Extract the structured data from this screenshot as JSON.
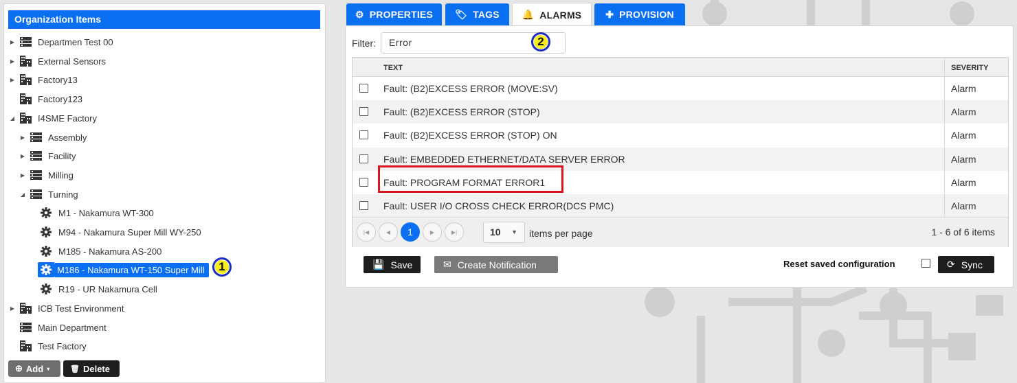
{
  "left": {
    "title": "Organization Items",
    "tree": [
      {
        "label": "Departmen Test 00",
        "icon": "server-icon",
        "arrow": "collapsed",
        "level": 0
      },
      {
        "label": "External Sensors",
        "icon": "building-icon",
        "arrow": "collapsed",
        "level": 0
      },
      {
        "label": "Factory13",
        "icon": "building-icon",
        "arrow": "collapsed",
        "level": 0
      },
      {
        "label": "Factory123",
        "icon": "building-icon",
        "arrow": "none",
        "level": 0
      },
      {
        "label": "I4SME Factory",
        "icon": "building-icon",
        "arrow": "expanded",
        "level": 0
      },
      {
        "label": "Assembly",
        "icon": "server-icon",
        "arrow": "collapsed",
        "level": 1
      },
      {
        "label": "Facility",
        "icon": "server-icon",
        "arrow": "collapsed",
        "level": 1
      },
      {
        "label": "Milling",
        "icon": "server-icon",
        "arrow": "collapsed",
        "level": 1
      },
      {
        "label": "Turning",
        "icon": "server-icon",
        "arrow": "expanded",
        "level": 1
      },
      {
        "label": "M1 - Nakamura WT-300",
        "icon": "gear-icon",
        "arrow": "none",
        "level": 2
      },
      {
        "label": "M94 - Nakamura Super Mill WY-250",
        "icon": "gear-icon",
        "arrow": "none",
        "level": 2
      },
      {
        "label": "M185 - Nakamura AS-200",
        "icon": "gear-icon",
        "arrow": "none",
        "level": 2
      },
      {
        "label": "M186 - Nakamura WT-150 Super Mill",
        "icon": "gear-icon",
        "arrow": "none",
        "level": 2,
        "selected": true
      },
      {
        "label": "R19 - UR Nakamura Cell",
        "icon": "gear-icon",
        "arrow": "none",
        "level": 2
      },
      {
        "label": "ICB Test Environment",
        "icon": "building-icon",
        "arrow": "collapsed",
        "level": 0
      },
      {
        "label": "Main Department",
        "icon": "server-icon",
        "arrow": "none",
        "level": 0
      },
      {
        "label": "Test Factory",
        "icon": "building-icon",
        "arrow": "none",
        "level": 0
      }
    ],
    "add_label": "Add",
    "delete_label": "Delete",
    "callout_1": "1"
  },
  "tabs": [
    {
      "label": "PROPERTIES",
      "icon": "gear-icon"
    },
    {
      "label": "TAGS",
      "icon": "tag-icon"
    },
    {
      "label": "ALARMS",
      "icon": "bell-icon",
      "active": true
    },
    {
      "label": "PROVISION",
      "icon": "plus-icon"
    }
  ],
  "alarms": {
    "filter_label": "Filter:",
    "filter_value": "Error",
    "callout_2": "2",
    "col_text": "TEXT",
    "col_severity": "SEVERITY",
    "rows": [
      {
        "text": "Fault: (B2)EXCESS ERROR (MOVE:SV)",
        "severity": "Alarm"
      },
      {
        "text": "Fault: (B2)EXCESS ERROR (STOP)",
        "severity": "Alarm"
      },
      {
        "text": "Fault: (B2)EXCESS ERROR (STOP) ON",
        "severity": "Alarm"
      },
      {
        "text": "Fault: EMBEDDED ETHERNET/DATA SERVER ERROR",
        "severity": "Alarm"
      },
      {
        "text": "Fault: PROGRAM FORMAT ERROR1",
        "severity": "Alarm"
      },
      {
        "text": "Fault: USER I/O CROSS CHECK ERROR(DCS PMC)",
        "severity": "Alarm"
      }
    ],
    "pager": {
      "current_page": "1",
      "page_size": "10",
      "per_page_label": "items per page",
      "info": "1 - 6 of 6 items"
    },
    "save_label": "Save",
    "notify_label": "Create Notification",
    "reset_label": "Reset saved configuration",
    "sync_label": "Sync"
  },
  "colors": {
    "accent": "#0a6ff0",
    "highlight": "#d8141c",
    "callout": "#f7ec1c"
  }
}
